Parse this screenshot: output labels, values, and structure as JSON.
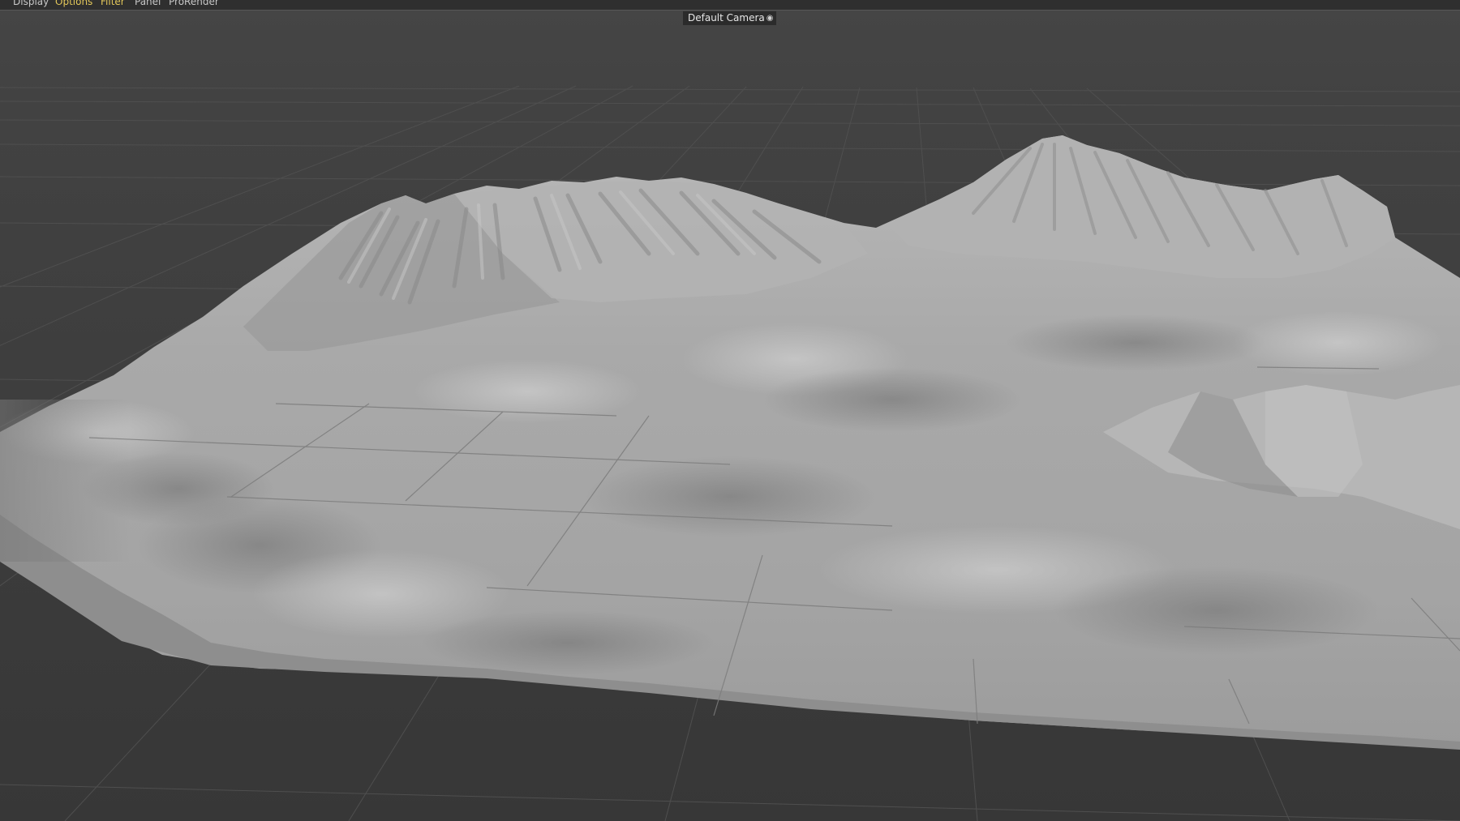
{
  "menu": {
    "items": [
      {
        "label": "Display",
        "color": "#c8c8c8"
      },
      {
        "label": "Options",
        "color": "#e3c75a"
      },
      {
        "label": "Filter",
        "color": "#e3c75a"
      },
      {
        "label": "Panel",
        "color": "#c8c8c8"
      },
      {
        "label": "ProRender",
        "color": "#c8c8c8"
      }
    ]
  },
  "viewport": {
    "camera_label": "Default Camera",
    "camera_icon": "camera-icon",
    "background_color": "#3b3b3b",
    "grid_color": "#4f4f4f",
    "terrain_color": "#a6a6a6"
  }
}
